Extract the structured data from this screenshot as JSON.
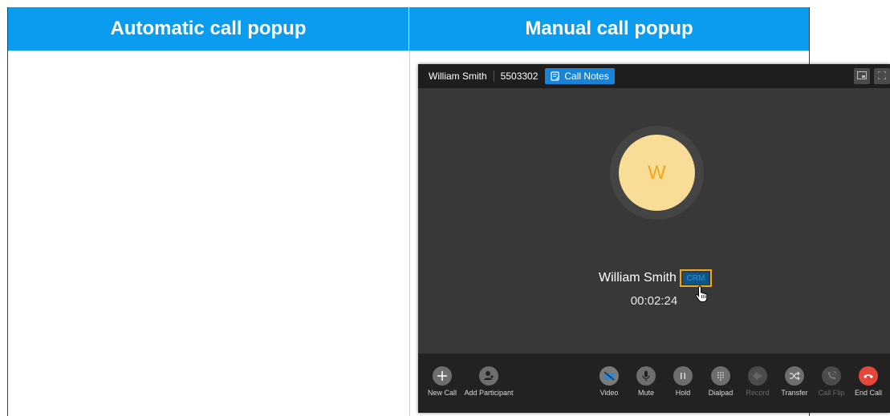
{
  "table": {
    "col_left_header": "Automatic call popup",
    "col_right_header": "Manual call popup"
  },
  "call": {
    "caller_name": "William Smith",
    "caller_number": "5503302",
    "notes_label": "Call Notes",
    "avatar_initial": "W",
    "contact_name": "William Smith",
    "crm_label": "CRM",
    "timer": "00:02:24"
  },
  "toolbar": {
    "new_call": "New Call",
    "add_participant": "Add Participant",
    "video": "Video",
    "mute": "Mute",
    "hold": "Hold",
    "dialpad": "Dialpad",
    "record": "Record",
    "transfer": "Transfer",
    "call_flip": "Call Flip",
    "end_call": "End Call"
  },
  "colors": {
    "header_blue": "#0b9cf0",
    "avatar_bg": "#f9dd96",
    "avatar_text": "#f0a71d",
    "crm_highlight": "#f0a71d",
    "end_call_red": "#e5483a",
    "notes_blue": "#1784d8"
  },
  "icons": [
    "notes-icon",
    "minimize-window-icon",
    "fullscreen-icon",
    "plus-icon",
    "add-person-icon",
    "video-off-icon",
    "microphone-icon",
    "pause-icon",
    "dialpad-icon",
    "record-icon",
    "transfer-icon",
    "call-flip-icon",
    "hang-up-icon",
    "hand-cursor-icon"
  ]
}
